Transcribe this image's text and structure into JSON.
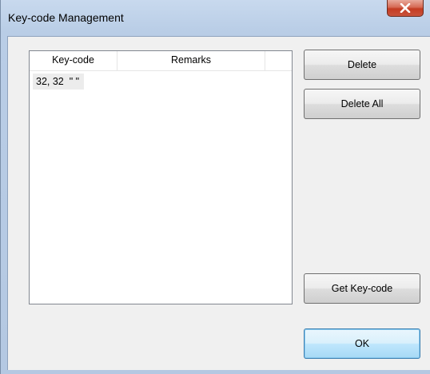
{
  "window": {
    "title": "Key-code Management",
    "close_glyph": "X"
  },
  "list": {
    "columns": [
      "Key-code",
      "Remarks"
    ],
    "rows": [
      {
        "text": "32, 32  \" \""
      }
    ]
  },
  "buttons": {
    "delete": "Delete",
    "delete_all": "Delete All",
    "get_key_code": "Get Key-code",
    "ok": "OK"
  },
  "colors": {
    "titlebar": "#b9cde6",
    "close_button": "#c43b22",
    "client_bg": "#f0f0f0",
    "default_button_border": "#3c7fb1"
  }
}
